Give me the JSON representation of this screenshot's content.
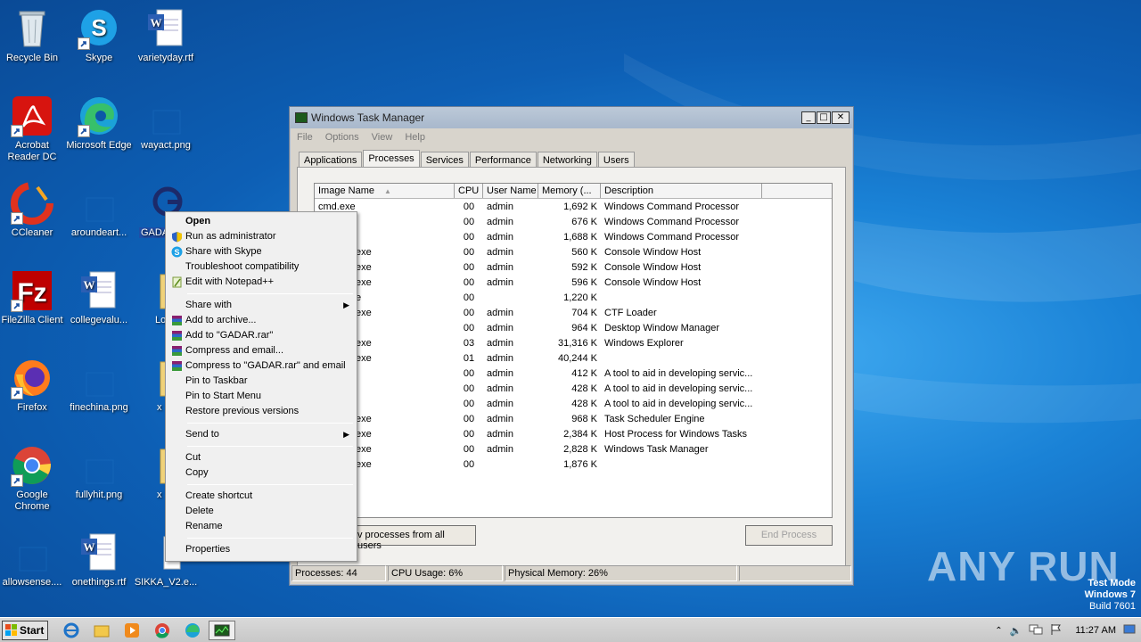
{
  "desktop": {
    "icons": [
      {
        "label": "Recycle Bin"
      },
      {
        "label": "Skype"
      },
      {
        "label": "varietyday.rtf"
      },
      {
        "label": "Acrobat Reader DC"
      },
      {
        "label": "Microsoft Edge"
      },
      {
        "label": "wayact.png"
      },
      {
        "label": "CCleaner"
      },
      {
        "label": "aroundeart..."
      },
      {
        "label": "GADA"
      },
      {
        "label": "FileZilla Client"
      },
      {
        "label": "collegevalu..."
      },
      {
        "label": "Lo"
      },
      {
        "label": "Firefox"
      },
      {
        "label": "finechina.png"
      },
      {
        "label": "x"
      },
      {
        "label": "Google Chrome"
      },
      {
        "label": "fullyhit.png"
      },
      {
        "label": "x"
      },
      {
        "label": "allowsense...."
      },
      {
        "label": "onethings.rtf"
      },
      {
        "label": "SIKKA_V2.e..."
      }
    ]
  },
  "taskmanager": {
    "title": "Windows Task Manager",
    "menu": [
      "File",
      "Options",
      "View",
      "Help"
    ],
    "tabs": [
      "Applications",
      "Processes",
      "Services",
      "Performance",
      "Networking",
      "Users"
    ],
    "active_tab": "Processes",
    "columns": [
      "Image Name",
      "CPU",
      "User Name",
      "Memory (...",
      "Description"
    ],
    "rows": [
      {
        "name": "cmd.exe",
        "cpu": "00",
        "user": "admin",
        "mem": "1,692 K",
        "desc": "Windows Command Processor"
      },
      {
        "name": "",
        "cpu": "00",
        "user": "admin",
        "mem": "676 K",
        "desc": "Windows Command Processor"
      },
      {
        "name": "",
        "cpu": "00",
        "user": "admin",
        "mem": "1,688 K",
        "desc": "Windows Command Processor"
      },
      {
        "name": "exe",
        "cpu": "00",
        "user": "admin",
        "mem": "560 K",
        "desc": "Console Window Host"
      },
      {
        "name": "exe",
        "cpu": "00",
        "user": "admin",
        "mem": "592 K",
        "desc": "Console Window Host"
      },
      {
        "name": "exe",
        "cpu": "00",
        "user": "admin",
        "mem": "596 K",
        "desc": "Console Window Host"
      },
      {
        "name": "e",
        "cpu": "00",
        "user": "",
        "mem": "1,220 K",
        "desc": ""
      },
      {
        "name": "exe",
        "cpu": "00",
        "user": "admin",
        "mem": "704 K",
        "desc": "CTF Loader"
      },
      {
        "name": "",
        "cpu": "00",
        "user": "admin",
        "mem": "964 K",
        "desc": "Desktop Window Manager"
      },
      {
        "name": "exe",
        "cpu": "03",
        "user": "admin",
        "mem": "31,316 K",
        "desc": "Windows Explorer"
      },
      {
        "name": "exe",
        "cpu": "01",
        "user": "admin",
        "mem": "40,244 K",
        "desc": ""
      },
      {
        "name": "",
        "cpu": "00",
        "user": "admin",
        "mem": "412 K",
        "desc": "A tool to aid in developing servic..."
      },
      {
        "name": "",
        "cpu": "00",
        "user": "admin",
        "mem": "428 K",
        "desc": "A tool to aid in developing servic..."
      },
      {
        "name": "",
        "cpu": "00",
        "user": "admin",
        "mem": "428 K",
        "desc": "A tool to aid in developing servic..."
      },
      {
        "name": "exe",
        "cpu": "00",
        "user": "admin",
        "mem": "968 K",
        "desc": "Task Scheduler Engine"
      },
      {
        "name": "exe",
        "cpu": "00",
        "user": "admin",
        "mem": "2,384 K",
        "desc": "Host Process for Windows Tasks"
      },
      {
        "name": "exe",
        "cpu": "00",
        "user": "admin",
        "mem": "2,828 K",
        "desc": "Windows Task Manager"
      },
      {
        "name": "exe",
        "cpu": "00",
        "user": "",
        "mem": "1,876 K",
        "desc": ""
      }
    ],
    "show_all_label": "v processes from all users",
    "end_process_label": "End Process",
    "status": {
      "processes": "Processes: 44",
      "cpu": "CPU Usage: 6%",
      "memory": "Physical Memory: 26%"
    }
  },
  "context_menu": {
    "items": [
      {
        "label": "Open",
        "bold": true
      },
      {
        "label": "Run as administrator",
        "icon": "shield-icon"
      },
      {
        "label": "Share with Skype",
        "icon": "skype-icon"
      },
      {
        "label": "Troubleshoot compatibility"
      },
      {
        "label": "Edit with Notepad++",
        "icon": "notepadpp-icon"
      },
      {
        "sep": true
      },
      {
        "label": "Share with",
        "submenu": true
      },
      {
        "label": "Add to archive...",
        "icon": "winrar-icon"
      },
      {
        "label": "Add to \"GADAR.rar\"",
        "icon": "winrar-icon"
      },
      {
        "label": "Compress and email...",
        "icon": "winrar-icon"
      },
      {
        "label": "Compress to \"GADAR.rar\" and email",
        "icon": "winrar-icon"
      },
      {
        "label": "Pin to Taskbar"
      },
      {
        "label": "Pin to Start Menu"
      },
      {
        "label": "Restore previous versions"
      },
      {
        "sep": true
      },
      {
        "label": "Send to",
        "submenu": true
      },
      {
        "sep": true
      },
      {
        "label": "Cut"
      },
      {
        "label": "Copy"
      },
      {
        "sep": true
      },
      {
        "label": "Create shortcut"
      },
      {
        "label": "Delete"
      },
      {
        "label": "Rename"
      },
      {
        "sep": true
      },
      {
        "label": "Properties"
      }
    ]
  },
  "taskbar": {
    "start_label": "Start",
    "clock": "11:27 AM"
  },
  "watermark": "ANY RUN",
  "testmode": {
    "line1": "Test Mode",
    "line2": "Windows 7",
    "line3": "Build 7601"
  }
}
